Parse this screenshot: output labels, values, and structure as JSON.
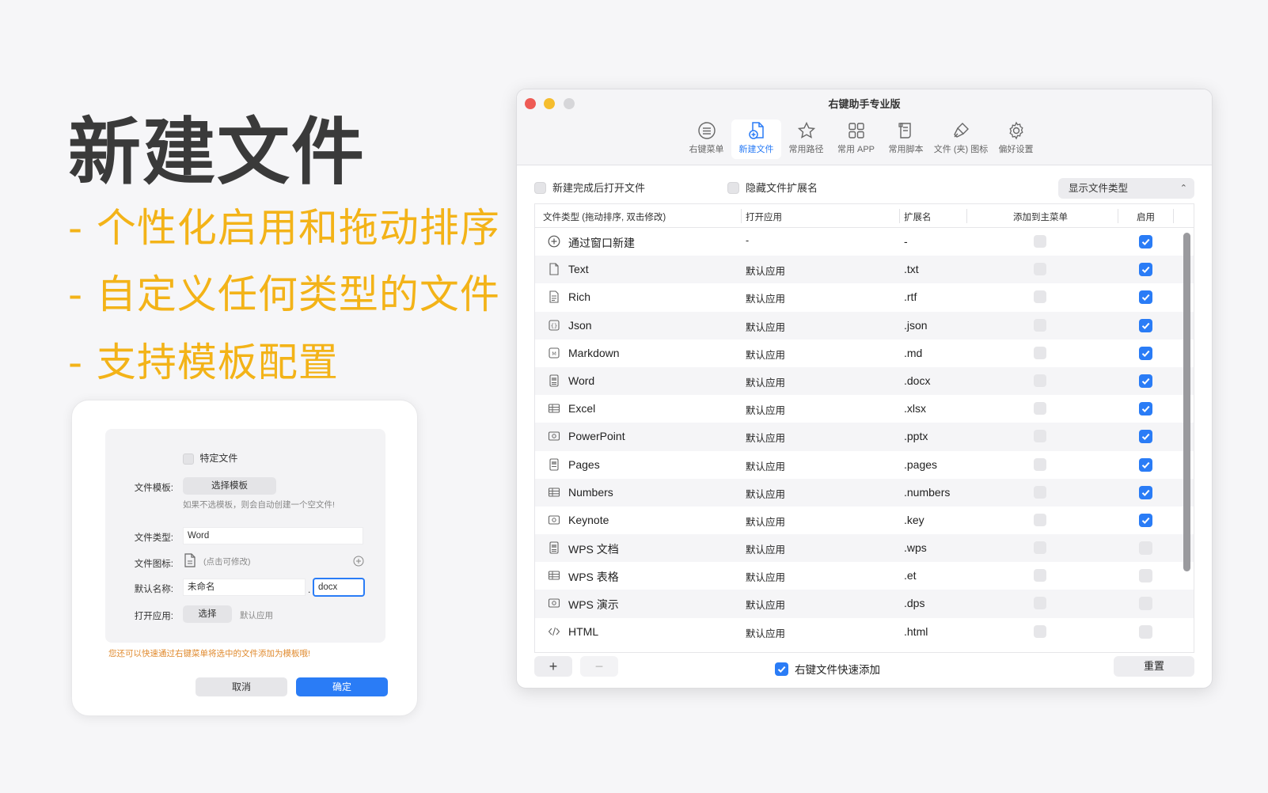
{
  "hero": {
    "title": "新建文件",
    "features": [
      "- 个性化启用和拖动排序",
      "- 自定义任何类型的文件",
      "- 支持模板配置"
    ]
  },
  "dialog": {
    "specific_file_label": "特定文件",
    "template_label": "文件模板:",
    "template_button": "选择模板",
    "template_hint": "如果不选模板，则会自动创建一个空文件!",
    "type_label": "文件类型:",
    "type_value": "Word",
    "icon_label": "文件图标:",
    "icon_hint": "(点击可修改)",
    "name_label": "默认名称:",
    "name_value": "未命名",
    "ext_separator": ".",
    "ext_value": "docx",
    "open_label": "打开应用:",
    "open_button": "选择",
    "open_value": "默认应用",
    "tip": "您还可以快速通过右键菜单将选中的文件添加为模板哦!",
    "cancel": "取消",
    "ok": "确定"
  },
  "window": {
    "title": "右键助手专业版",
    "tabs": [
      {
        "label": "右键菜单",
        "icon": "list-icon"
      },
      {
        "label": "新建文件",
        "icon": "new-file-icon",
        "active": true
      },
      {
        "label": "常用路径",
        "icon": "star-icon"
      },
      {
        "label": "常用 APP",
        "icon": "grid-icon"
      },
      {
        "label": "常用脚本",
        "icon": "script-icon"
      },
      {
        "label": "文件 (夹) 图标",
        "icon": "brush-icon"
      },
      {
        "label": "偏好设置",
        "icon": "gear-icon"
      }
    ],
    "options": {
      "open_after_create": "新建完成后打开文件",
      "hide_extension": "隐藏文件扩展名",
      "display_select": "显示文件类型"
    },
    "table": {
      "headers": [
        "文件类型 (拖动排序, 双击修改)",
        "打开应用",
        "扩展名",
        "添加到主菜单",
        "启用"
      ],
      "rows": [
        {
          "icon": "plus-circle-icon",
          "name": "通过窗口新建",
          "app": "-",
          "ext": "-",
          "enabled": true
        },
        {
          "icon": "text-file-icon",
          "name": "Text",
          "app": "默认应用",
          "ext": ".txt",
          "enabled": true
        },
        {
          "icon": "rich-file-icon",
          "name": "Rich",
          "app": "默认应用",
          "ext": ".rtf",
          "enabled": true
        },
        {
          "icon": "json-file-icon",
          "name": "Json",
          "app": "默认应用",
          "ext": ".json",
          "enabled": true
        },
        {
          "icon": "markdown-file-icon",
          "name": "Markdown",
          "app": "默认应用",
          "ext": ".md",
          "enabled": true
        },
        {
          "icon": "word-file-icon",
          "name": "Word",
          "app": "默认应用",
          "ext": ".docx",
          "enabled": true
        },
        {
          "icon": "table-icon",
          "name": "Excel",
          "app": "默认应用",
          "ext": ".xlsx",
          "enabled": true
        },
        {
          "icon": "slides-icon",
          "name": "PowerPoint",
          "app": "默认应用",
          "ext": ".pptx",
          "enabled": true
        },
        {
          "icon": "pages-file-icon",
          "name": "Pages",
          "app": "默认应用",
          "ext": ".pages",
          "enabled": true
        },
        {
          "icon": "table-icon",
          "name": "Numbers",
          "app": "默认应用",
          "ext": ".numbers",
          "enabled": true
        },
        {
          "icon": "slides-icon",
          "name": "Keynote",
          "app": "默认应用",
          "ext": ".key",
          "enabled": true
        },
        {
          "icon": "word-file-icon",
          "name": "WPS 文档",
          "app": "默认应用",
          "ext": ".wps",
          "enabled": false
        },
        {
          "icon": "table-icon",
          "name": "WPS 表格",
          "app": "默认应用",
          "ext": ".et",
          "enabled": false
        },
        {
          "icon": "slides-icon",
          "name": "WPS 演示",
          "app": "默认应用",
          "ext": ".dps",
          "enabled": false
        },
        {
          "icon": "code-icon",
          "name": "HTML",
          "app": "默认应用",
          "ext": ".html",
          "enabled": false
        }
      ]
    },
    "footer": {
      "add": "+",
      "remove": "−",
      "quick_add": "右键文件快速添加",
      "reset": "重置"
    }
  },
  "colors": {
    "accent": "#2a7cf6",
    "feature_yellow": "#f3b318",
    "tip_orange": "#e08a2e"
  }
}
